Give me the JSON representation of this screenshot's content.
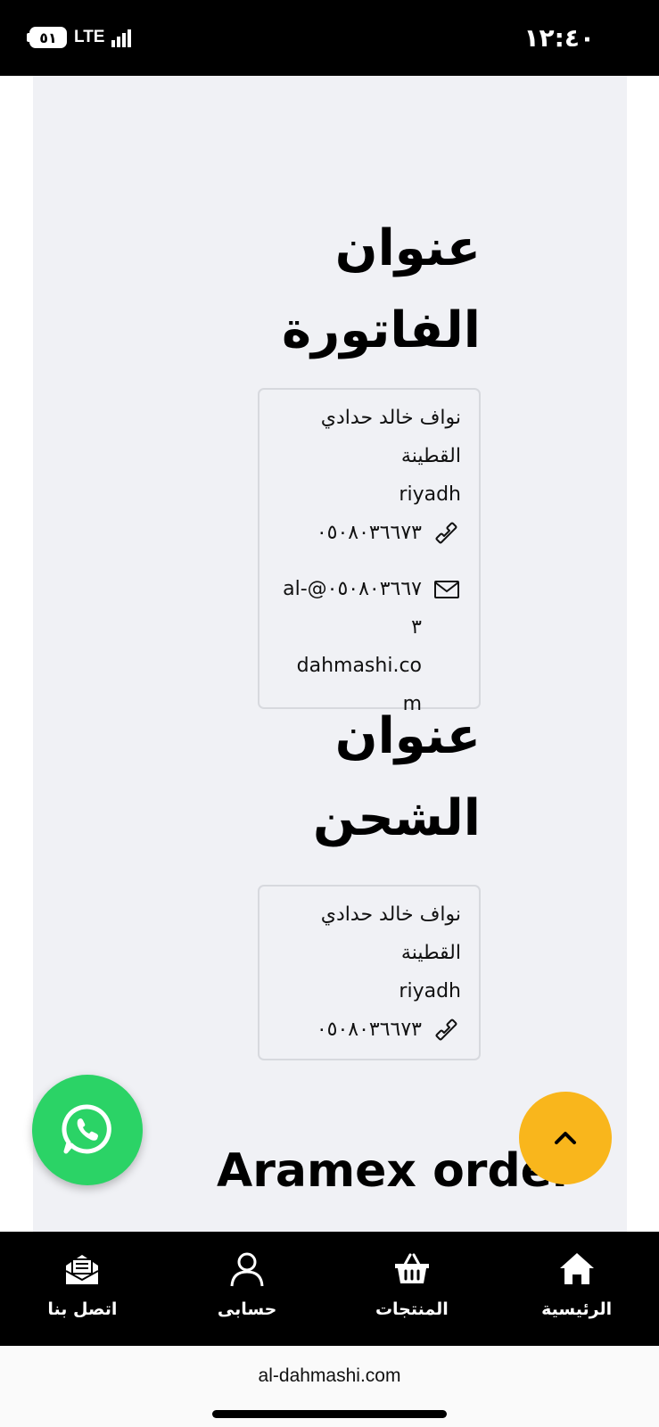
{
  "status_bar": {
    "time": "١٢:٤٠",
    "network": "LTE",
    "battery": "٥١"
  },
  "billing": {
    "title_line1": "عنوان",
    "title_line2": "الفاتورة",
    "name_line1": "نواف خالد حدادي",
    "name_line2": "القطينة",
    "city": "riyadh",
    "phone": "٠٥٠٨٠٣٦٦٧٣",
    "email_line1": "al-@٠٥٠٨٠٣٦٦٧٣",
    "email_line2": "dahmashi.co",
    "email_line3": "m"
  },
  "shipping": {
    "title_line1": "عنوان",
    "title_line2": "الشحن",
    "name_line1": "نواف خالد حدادي",
    "name_line2": "القطينة",
    "city": "riyadh",
    "phone": "٠٥٠٨٠٣٦٦٧٣"
  },
  "aramex": {
    "title": "Aramex order"
  },
  "bottom_nav": {
    "items": [
      {
        "label": "الرئيسية",
        "icon": "home-icon"
      },
      {
        "label": "المنتجات",
        "icon": "basket-icon"
      },
      {
        "label": "حسابى",
        "icon": "user-icon"
      },
      {
        "label": "اتصل بنا",
        "icon": "mail-icon"
      }
    ]
  },
  "url_bar": {
    "url": "al-dahmashi.com"
  },
  "colors": {
    "whatsapp": "#2bd366",
    "scroll_top": "#f9b61c",
    "content_bg": "#f0f1f5"
  }
}
